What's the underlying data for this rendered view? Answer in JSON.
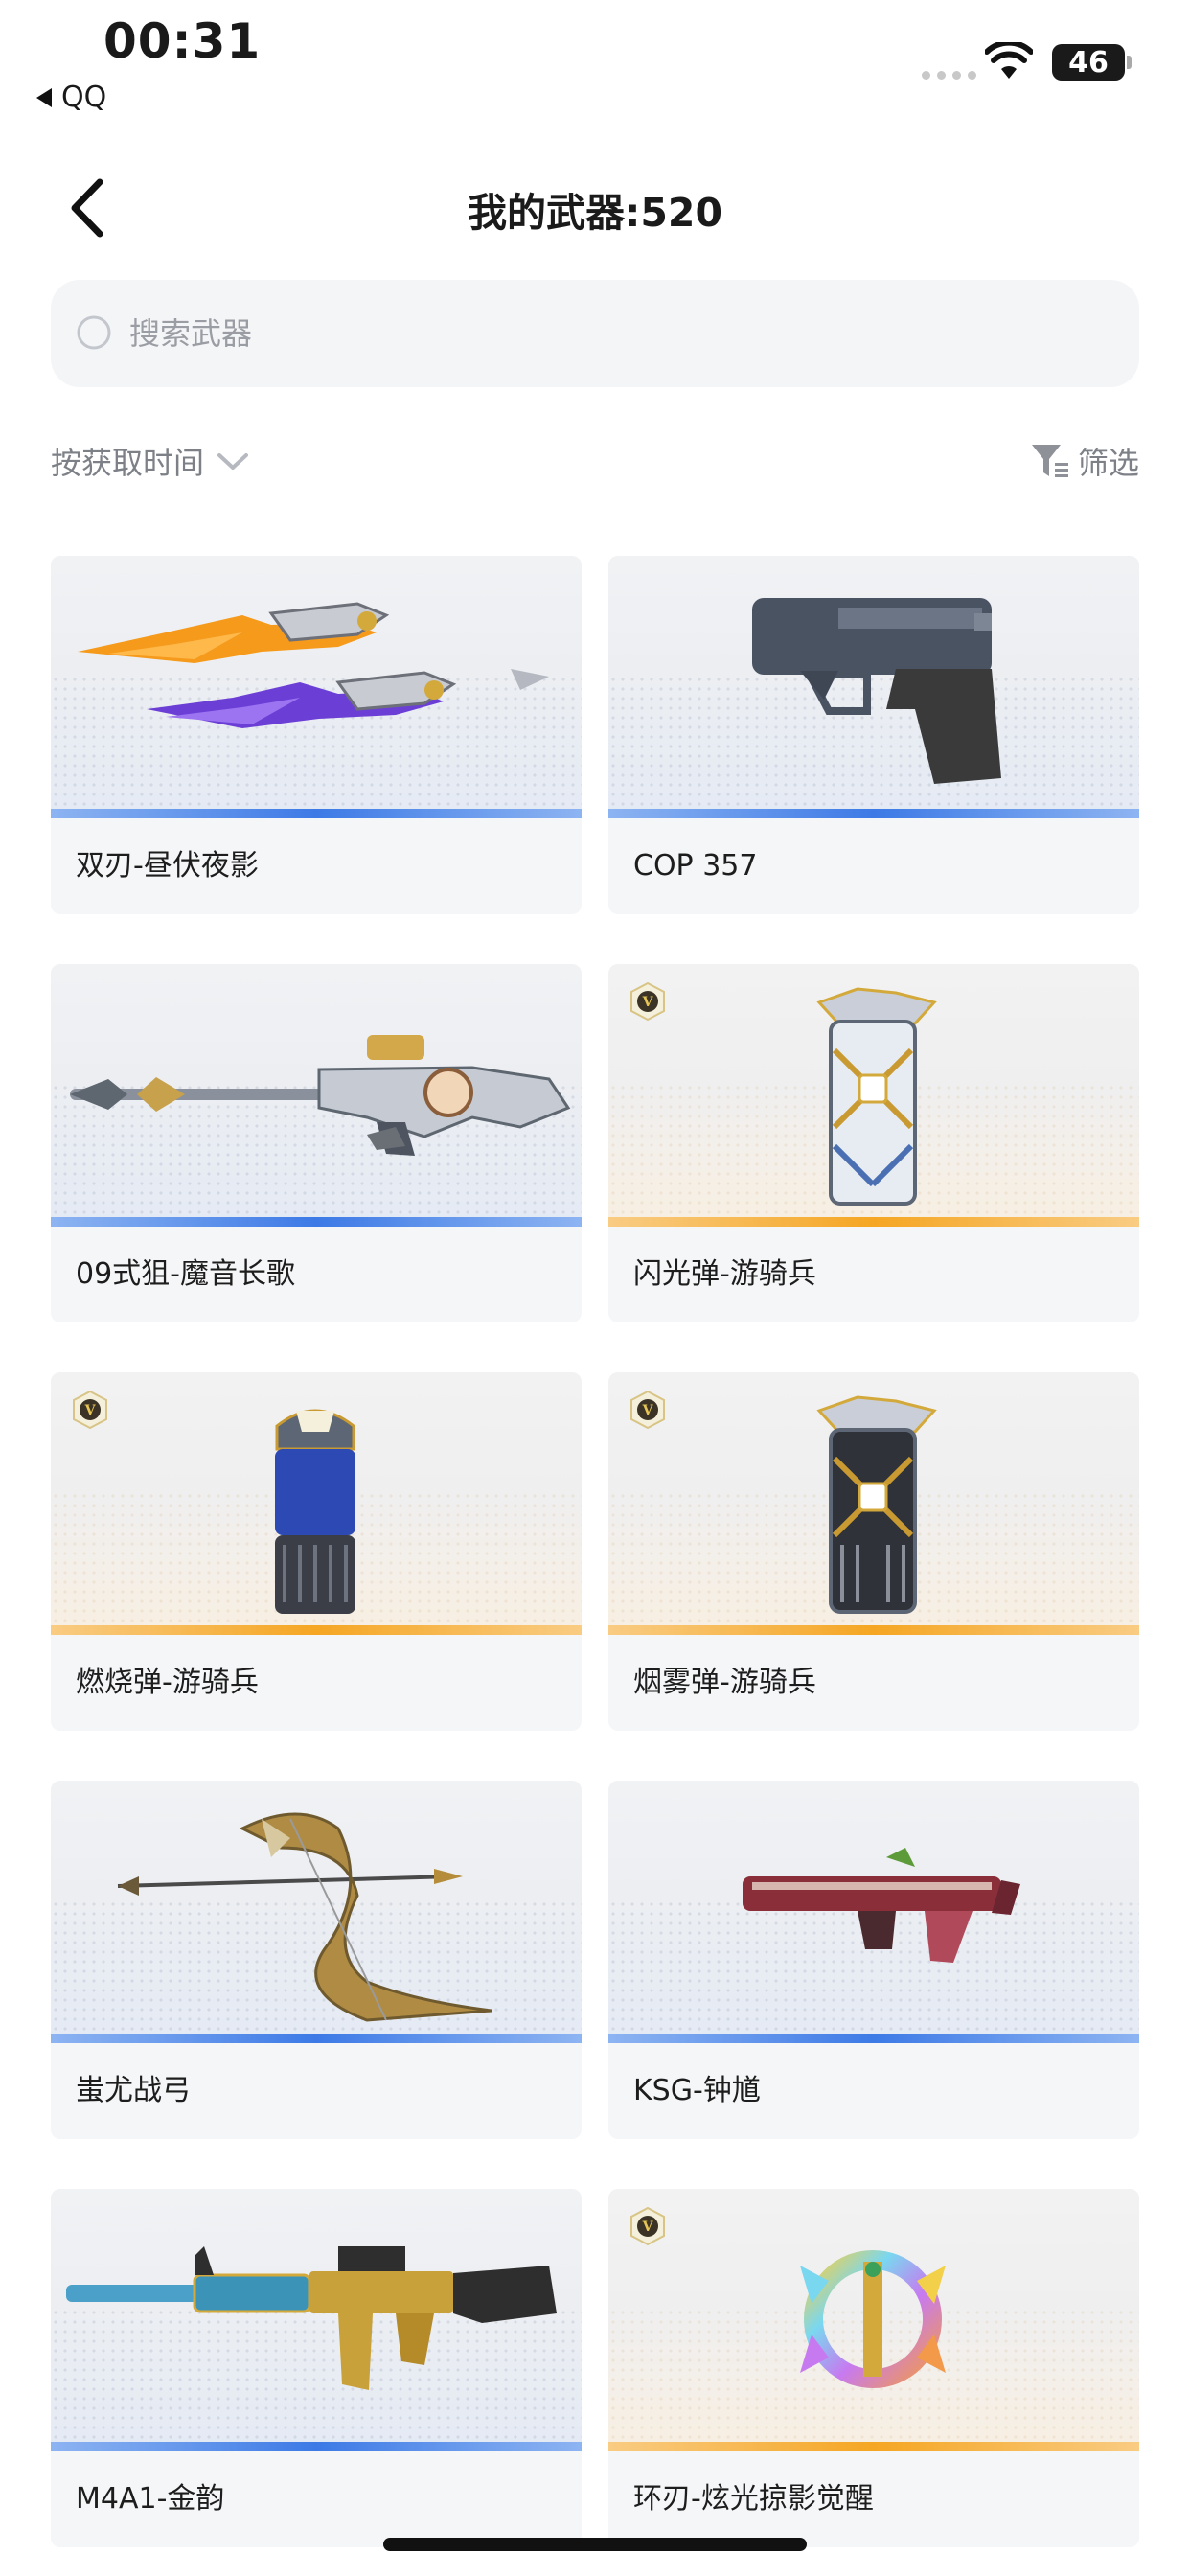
{
  "status_bar": {
    "time": "00:31",
    "back_app": "QQ",
    "battery": "46"
  },
  "header": {
    "title": "我的武器:520"
  },
  "search": {
    "placeholder": "搜索武器"
  },
  "sort": {
    "label": "按获取时间"
  },
  "filter": {
    "label": "筛选"
  },
  "weapons": [
    {
      "name": "双刃-昼伏夜影",
      "rarity": "blue",
      "vip": false,
      "icon": "dual-blade-weapon-icon"
    },
    {
      "name": "COP 357",
      "rarity": "blue",
      "vip": false,
      "icon": "pistol-weapon-icon"
    },
    {
      "name": "09式狙-魔音长歌",
      "rarity": "blue",
      "vip": false,
      "icon": "sniper-rifle-weapon-icon"
    },
    {
      "name": "闪光弹-游骑兵",
      "rarity": "orange",
      "vip": true,
      "icon": "flash-grenade-weapon-icon"
    },
    {
      "name": "燃烧弹-游骑兵",
      "rarity": "orange",
      "vip": true,
      "icon": "incendiary-grenade-weapon-icon"
    },
    {
      "name": "烟雾弹-游骑兵",
      "rarity": "orange",
      "vip": true,
      "icon": "smoke-grenade-weapon-icon"
    },
    {
      "name": "蚩尤战弓",
      "rarity": "blue",
      "vip": false,
      "icon": "bow-weapon-icon"
    },
    {
      "name": "KSG-钟馗",
      "rarity": "blue",
      "vip": false,
      "icon": "shotgun-weapon-icon"
    },
    {
      "name": "M4A1-金韵",
      "rarity": "blue",
      "vip": false,
      "icon": "assault-rifle-weapon-icon"
    },
    {
      "name": "环刃-炫光掠影觉醒",
      "rarity": "orange",
      "vip": true,
      "icon": "ring-blade-weapon-icon"
    }
  ],
  "colors": {
    "blue_rarity": "#3d7ae6",
    "orange_rarity": "#f5a623",
    "vip_gold": "#c9a13a"
  }
}
